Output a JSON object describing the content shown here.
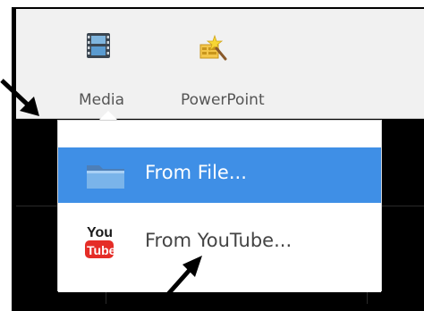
{
  "toolbar": {
    "media_label": "Media",
    "powerpoint_label": "PowerPoint"
  },
  "menu": {
    "items": [
      {
        "label": "From File...",
        "icon": "folder-icon",
        "selected": true
      },
      {
        "label": "From YouTube...",
        "icon": "youtube-icon",
        "selected": false
      }
    ]
  },
  "icons": {
    "media": "film-icon",
    "powerpoint": "powerpoint-wand-icon"
  },
  "youtube_logo": {
    "top": "You",
    "bottom": "Tube"
  },
  "colors": {
    "selected_bg": "#3f8fe6",
    "toolbar_bg": "#f1f1f1",
    "canvas_bg": "#000000",
    "youtube_red": "#e52d27"
  }
}
